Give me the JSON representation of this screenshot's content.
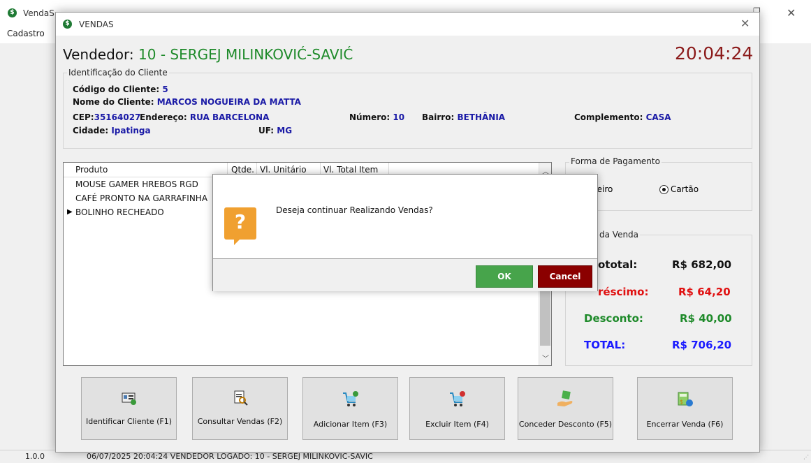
{
  "main_window": {
    "title": "VendaS",
    "menu": [
      "Cadastro"
    ],
    "status": {
      "version": "1.0.0",
      "text": "06/07/2025 20:04:24   VENDEDOR LOGADO:  10 - SERGEJ MILINKOVIC-SAVIC"
    }
  },
  "vendas_window": {
    "title": "VENDAS",
    "seller_label": "Vendedor:",
    "seller_value": "10 - SERGEJ MILINKOVIĆ-SAVIĆ",
    "clock": "20:04:24",
    "client": {
      "legend": "Identificação do Cliente",
      "code_label": "Código do Cliente:",
      "code_value": "5",
      "name_label": "Nome do Cliente:",
      "name_value": "MARCOS NOGUEIRA DA MATTA",
      "cep_label": "CEP:",
      "cep_value": "35164027",
      "address_label": "Endereço:",
      "address_value": "RUA BARCELONA",
      "number_label": "Número:",
      "number_value": "10",
      "district_label": "Bairro:",
      "district_value": "BETHÂNIA",
      "complement_label": "Complemento:",
      "complement_value": "CASA",
      "city_label": "Cidade:",
      "city_value": "Ipatinga",
      "uf_label": "UF:",
      "uf_value": "MG"
    },
    "items_grid": {
      "columns": [
        "Produto",
        "Qtde.",
        "Vl. Unitário",
        "Vl. Total Item"
      ],
      "rows": [
        "MOUSE GAMER HREBOS RGD",
        "CAFÉ PRONTO NA GARRAFINHA",
        "BOLINHO RECHEADO"
      ]
    },
    "payment": {
      "legend": "Forma de Pagamento",
      "option_cash_partial": "heiro",
      "option_card": "Cartão",
      "selected": "Cartão"
    },
    "summary": {
      "legend_partial": "da Venda",
      "subtotal_label_partial": "ototal:",
      "subtotal_value": "R$ 682,00",
      "addition_label_partial": "réscimo:",
      "addition_value": "R$ 64,20",
      "discount_label": "Desconto:",
      "discount_value": "R$ 40,00",
      "total_label": "TOTAL:",
      "total_value": "R$ 706,20"
    },
    "actions": [
      {
        "label": "Identificar Cliente (F1)",
        "icon": "id-card-icon"
      },
      {
        "label": "Consultar Vendas (F2)",
        "icon": "search-document-icon"
      },
      {
        "label": "Adicionar Item (F3)",
        "icon": "cart-add-icon"
      },
      {
        "label": "Excluir Item (F4)",
        "icon": "cart-remove-icon"
      },
      {
        "label": "Conceder Desconto (F5)",
        "icon": "discount-hand-icon"
      },
      {
        "label": "Encerrar Venda (F6)",
        "icon": "cash-register-icon"
      }
    ]
  },
  "dialog": {
    "message": "Deseja continuar Realizando Vendas?",
    "ok_label": "OK",
    "cancel_label": "Cancel",
    "icon": "question-icon"
  },
  "colors": {
    "seller_name": "#1e8a2a",
    "clock": "#8b1a1a",
    "value_blue": "#1a1aa6",
    "ok_green": "#47a44b",
    "cancel_red": "#8b0000",
    "addition_red": "#e01010",
    "discount_green": "#1e8a2a",
    "total_blue": "#1a1aff"
  }
}
